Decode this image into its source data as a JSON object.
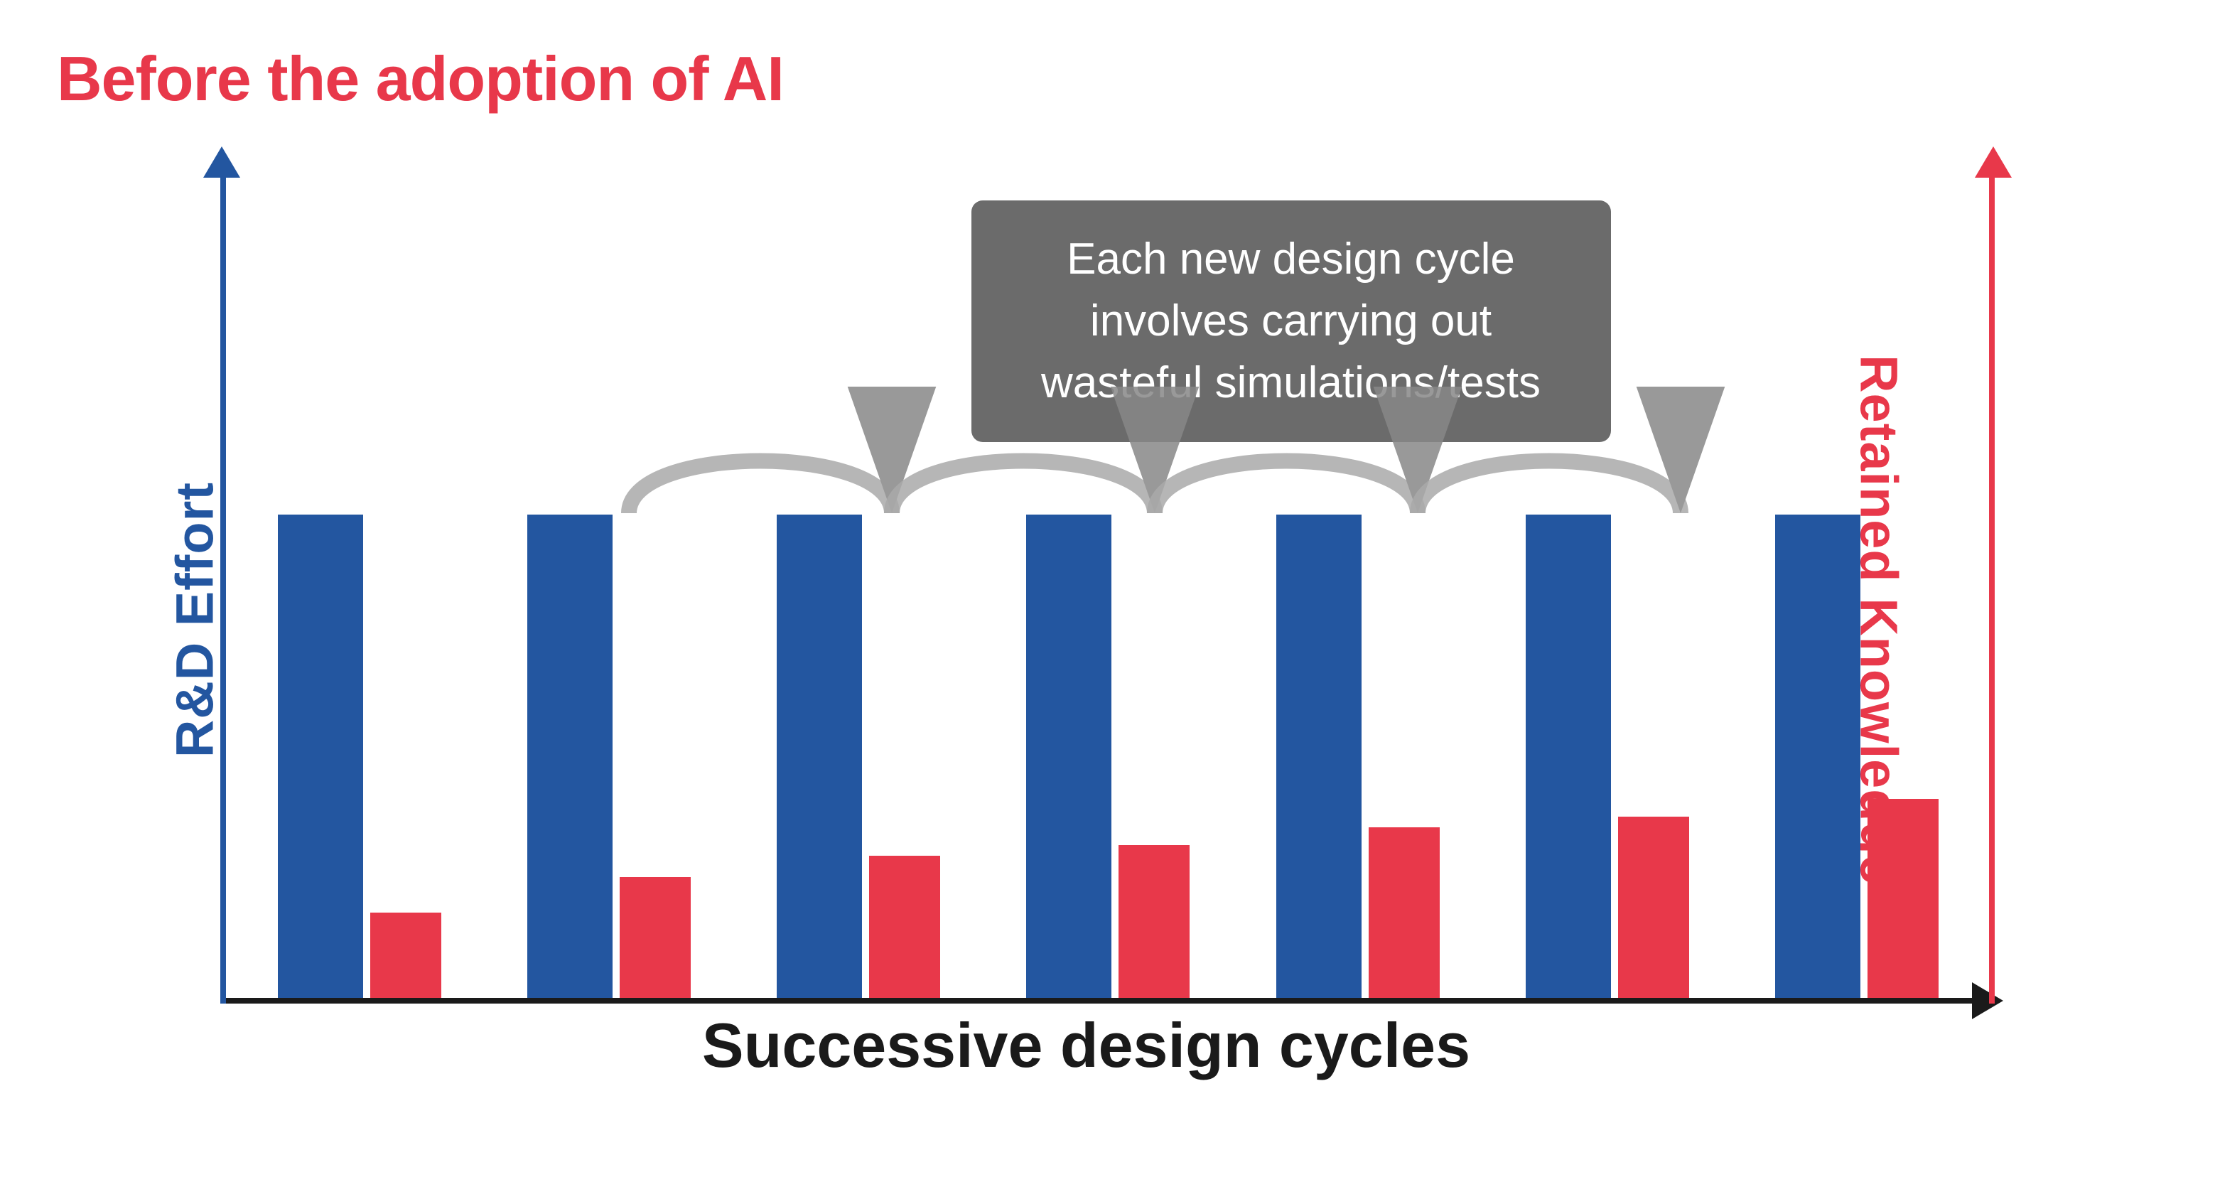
{
  "title": "Before the adoption of AI",
  "y_axis_left_label": "R&D Effort",
  "y_axis_right_label": "Retained Knowledge",
  "x_axis_label": "Successive design cycles",
  "annotation": {
    "line1": "Each new design cycle",
    "line2": "involves carrying out",
    "line3": "wasteful simulations/tests"
  },
  "colors": {
    "title": "#e8384a",
    "blue": "#2356a0",
    "red": "#e8384a",
    "axis": "#1a1a1a",
    "annotation_bg": "#6b6b6b",
    "annotation_text": "#ffffff"
  },
  "bars": [
    {
      "blue_height": 680,
      "red_height": 120
    },
    {
      "blue_height": 680,
      "red_height": 170
    },
    {
      "blue_height": 680,
      "red_height": 200
    },
    {
      "blue_height": 680,
      "red_height": 215
    },
    {
      "blue_height": 680,
      "red_height": 240
    },
    {
      "blue_height": 680,
      "red_height": 255
    },
    {
      "blue_height": 680,
      "red_height": 280
    }
  ]
}
